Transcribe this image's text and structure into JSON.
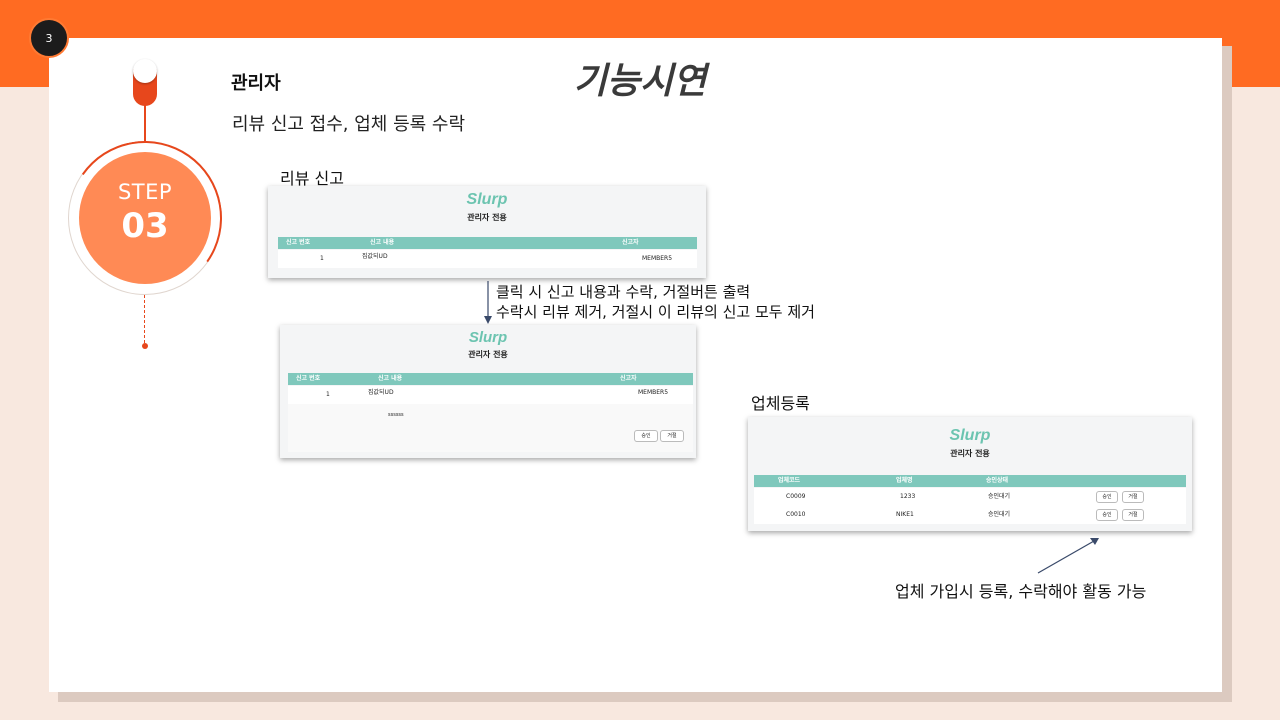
{
  "page_number": "3",
  "title": "기능시연",
  "step": {
    "word": "STEP",
    "number": "03"
  },
  "role": "관리자",
  "subtitle": "리뷰 신고 접수, 업체 등록 수락",
  "section_report": {
    "label": "리뷰 신고"
  },
  "note_report": {
    "line1": "클릭 시 신고 내용과 수락, 거절버튼 출력",
    "line2": "수락시 리뷰 제거, 거절시 이 리뷰의 신고 모두 제거"
  },
  "section_vendor": {
    "label": "업체등록"
  },
  "note_vendor": "업체 가입시 등록, 수락해야 활동 가능",
  "app": {
    "logo": "Slurp",
    "admin_title": "관리자 전용"
  },
  "report_table": {
    "columns": [
      "신고 번호",
      "신고 내용",
      "신고자"
    ],
    "rows": [
      {
        "no": "1",
        "content": "집값되UD",
        "reporter": "MEMBER5"
      }
    ]
  },
  "report_expanded": {
    "detail": "ssssss",
    "accept_label": "승인",
    "reject_label": "거절"
  },
  "vendor_table": {
    "columns": [
      "업체코드",
      "업체명",
      "승인상태"
    ],
    "rows": [
      {
        "code": "C0009",
        "name": "1233",
        "status": "승인대기",
        "accept": "승인",
        "reject": "거절"
      },
      {
        "code": "C0010",
        "name": "NIKE1",
        "status": "승인대기",
        "accept": "승인",
        "reject": "거절"
      }
    ]
  },
  "colors": {
    "accent": "#ff6b22",
    "step_red": "#e7471c",
    "table_header": "#7fc8bc",
    "logo": "#6cc4b0"
  }
}
